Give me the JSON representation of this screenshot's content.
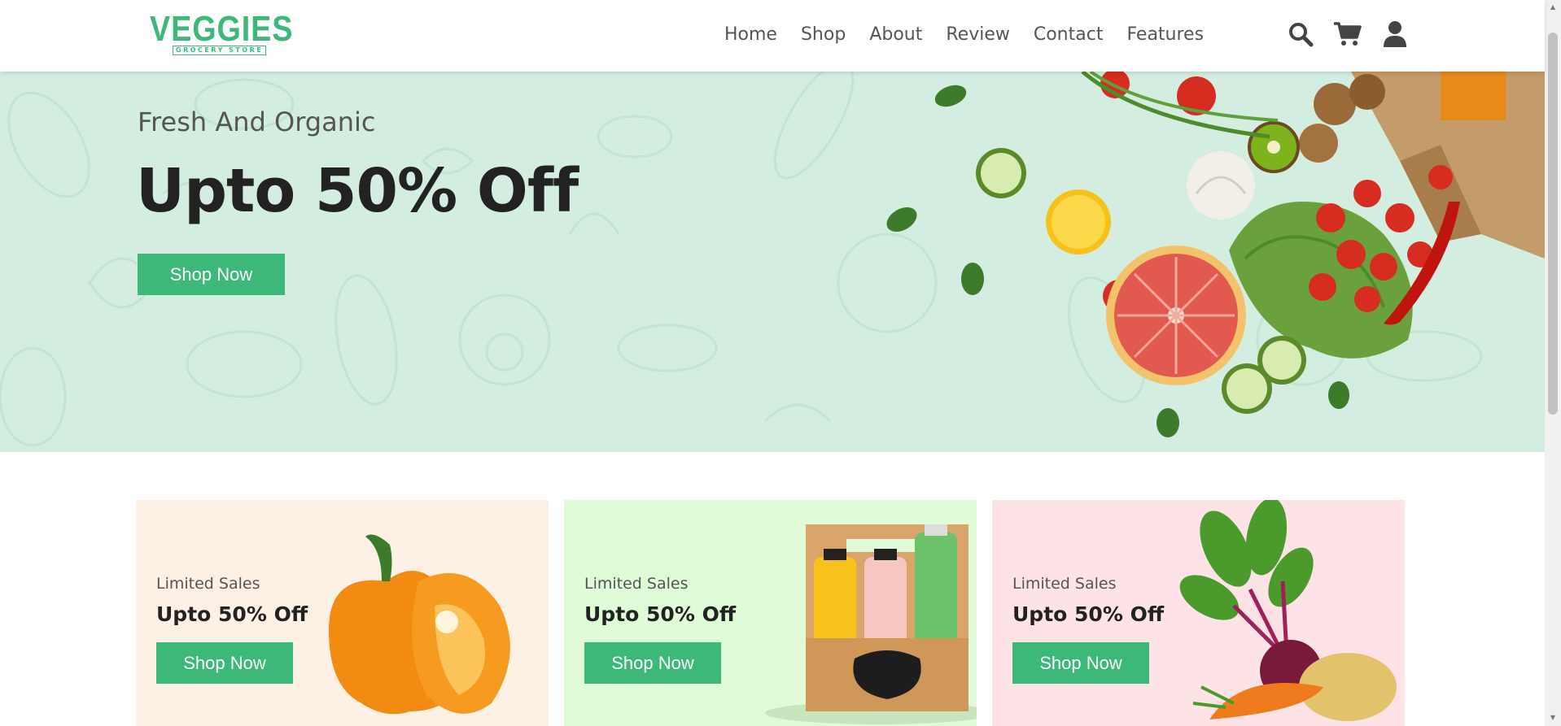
{
  "brand": {
    "logo_main": "VEGGIES",
    "logo_sub": "GROCERY STORE",
    "accent": "#3cb878"
  },
  "nav": {
    "items": [
      {
        "label": "Home"
      },
      {
        "label": "Shop"
      },
      {
        "label": "About"
      },
      {
        "label": "Review"
      },
      {
        "label": "Contact"
      },
      {
        "label": "Features"
      }
    ]
  },
  "header_icons": [
    "search-icon",
    "cart-icon",
    "user-icon"
  ],
  "hero": {
    "subtitle": "Fresh And Organic",
    "title": "Upto 50% Off",
    "button": "Shop Now",
    "background": "#d3eee1"
  },
  "promos": [
    {
      "sub": "Limited Sales",
      "title": "Upto 50% Off",
      "button": "Shop Now",
      "background": "#fdf1e6",
      "art": "bell-pepper"
    },
    {
      "sub": "Limited Sales",
      "title": "Upto 50% Off",
      "button": "Shop Now",
      "background": "#e0fbd8",
      "art": "smoothie-bottles"
    },
    {
      "sub": "Limited Sales",
      "title": "Upto 50% Off",
      "button": "Shop Now",
      "background": "#fde3e5",
      "art": "beetroot-carrot-potato"
    }
  ]
}
